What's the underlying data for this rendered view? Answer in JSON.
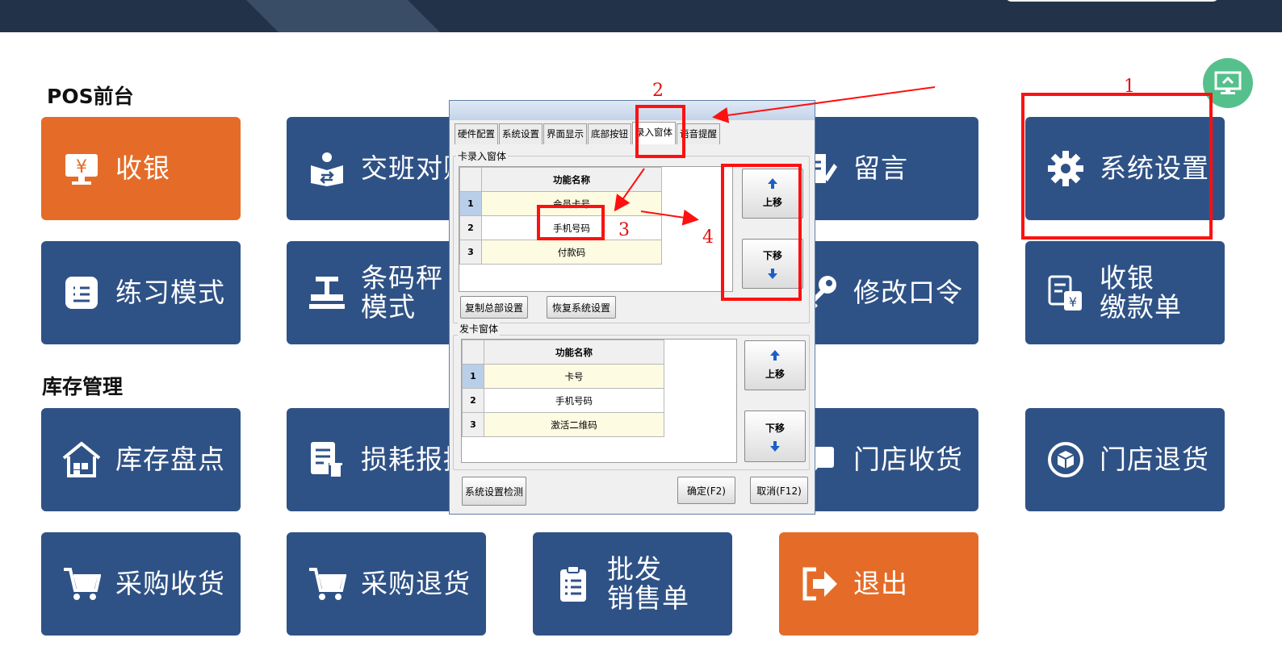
{
  "sections": {
    "pos_title": "POS前台",
    "stock_title": "库存管理"
  },
  "tiles": {
    "cashier": "收银",
    "shift": "交班对账",
    "message": "留言",
    "system_settings": "系统设置",
    "practice": "练习模式",
    "barcode_scale": "条码秤\n模式",
    "change_password": "修改口令",
    "cashier_bill": "收银\n缴款单",
    "inventory": "库存盘点",
    "loss_report": "损耗报损",
    "store_receive": "门店收货",
    "store_return": "门店退货",
    "purchase_receive": "采购收货",
    "purchase_return": "采购退货",
    "wholesale": "批发\n销售单",
    "exit": "退出"
  },
  "dialog": {
    "tabs": [
      "硬件配置",
      "系统设置",
      "界面显示",
      "底部按钮",
      "录入窗体",
      "语音提醒"
    ],
    "card_entry_group": "卡录入窗体",
    "card_issue_group": "发卡窗体",
    "column_header": "功能名称",
    "card_entry_rows": [
      {
        "idx": "1",
        "name": "会员卡号"
      },
      {
        "idx": "2",
        "name": "手机号码"
      },
      {
        "idx": "3",
        "name": "付款码"
      }
    ],
    "card_issue_rows": [
      {
        "idx": "1",
        "name": "卡号"
      },
      {
        "idx": "2",
        "name": "手机号码"
      },
      {
        "idx": "3",
        "name": "激活二维码"
      }
    ],
    "move_up": "上移",
    "move_down": "下移",
    "copy_all": "复制总部设置",
    "restore": "恢复系统设置",
    "check": "系统设置检测",
    "ok": "确定(F2)",
    "cancel": "取消(F12)"
  },
  "annotations": {
    "n1": "1",
    "n2": "2",
    "n3": "3",
    "n4": "4"
  },
  "colors": {
    "tile_blue": "#2f5286",
    "tile_orange": "#e46c28",
    "annotation_red": "#ff1010",
    "header_dark": "#223249"
  }
}
